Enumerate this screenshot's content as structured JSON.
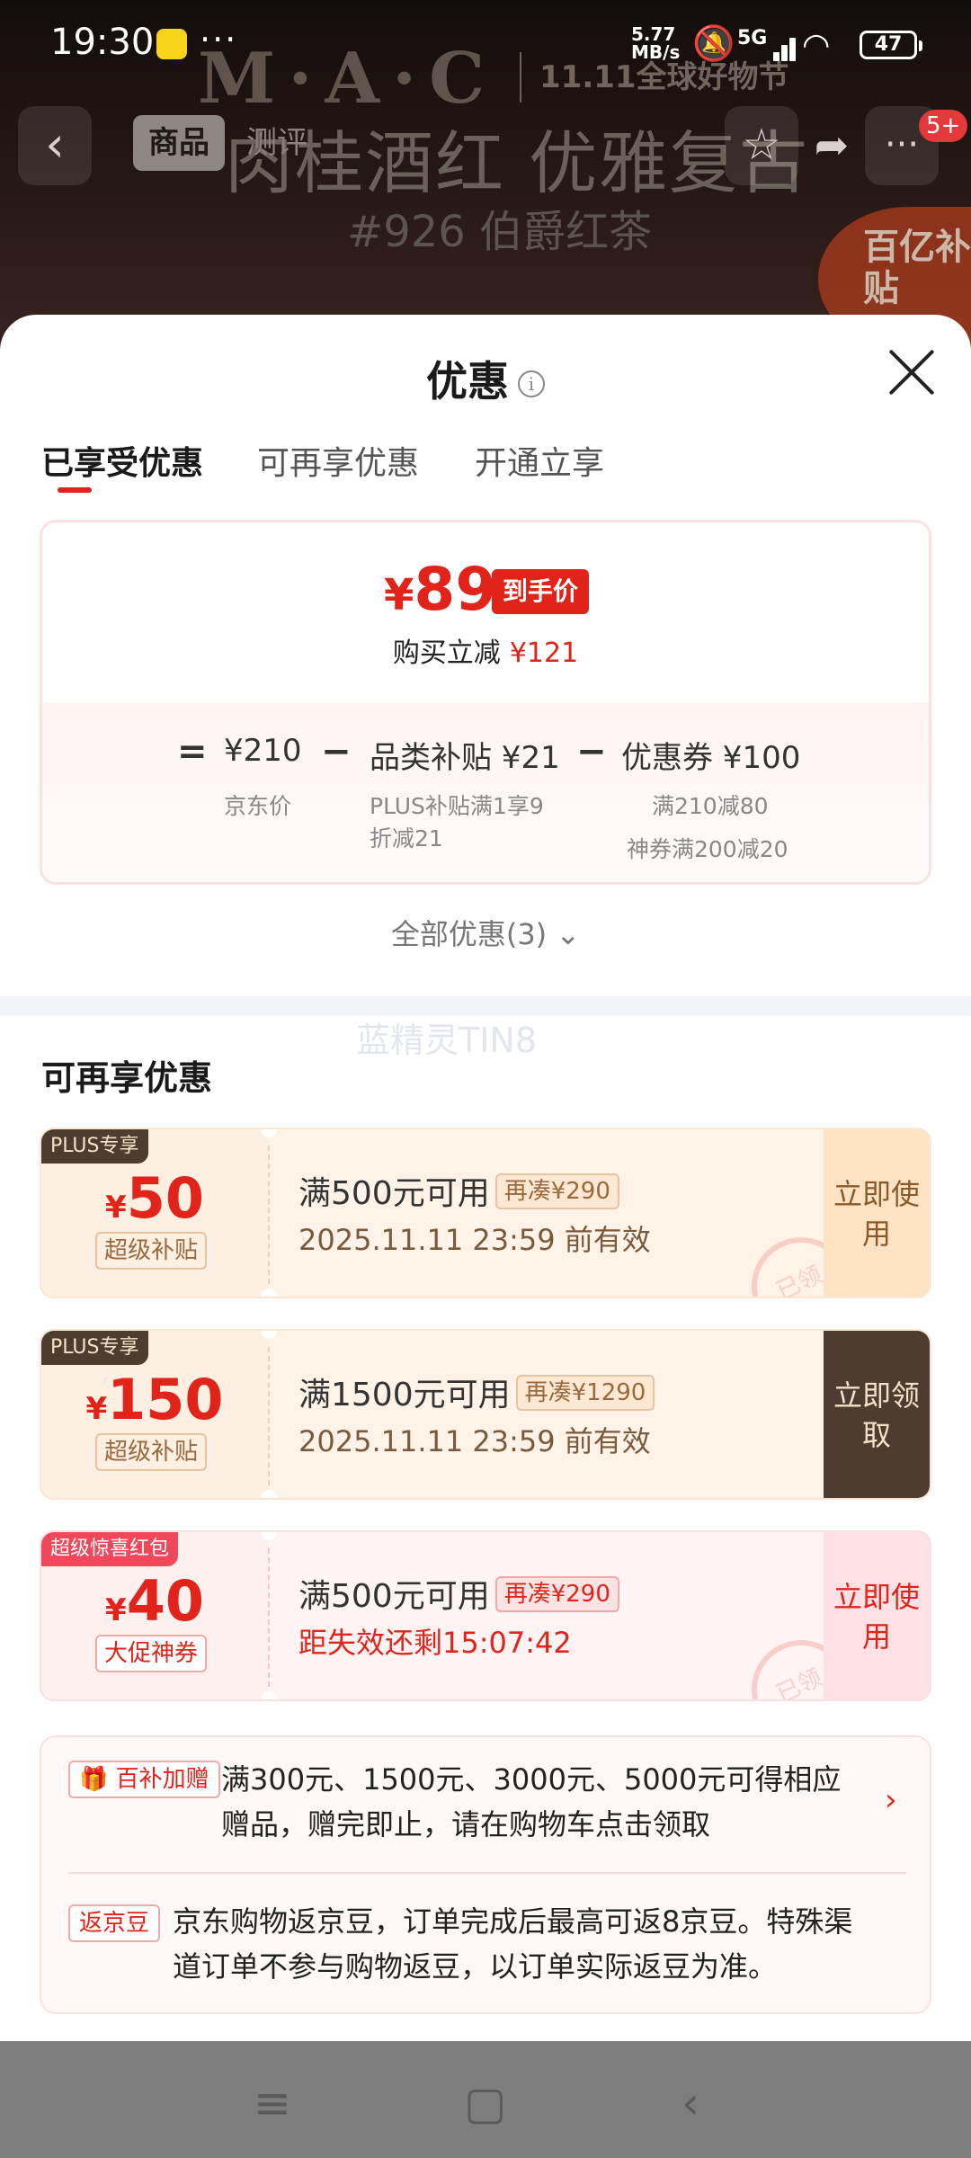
{
  "status_bar": {
    "time": "19:30",
    "dots": "···",
    "net_speed_value": "5.77",
    "net_speed_unit": "MB/s",
    "network": "5G",
    "battery": "47"
  },
  "background": {
    "brand": "M·A·C",
    "festival": "11.11全球好物节",
    "headline": "肉桂酒红 优雅复古",
    "shade": "#926 伯爵红茶",
    "badge": "百亿补贴"
  },
  "nav": {
    "tab_product": "商品",
    "tab_review": "测评",
    "more_badge": "5+"
  },
  "sheet": {
    "title": "优惠",
    "tabs": [
      "已享受优惠",
      "可再享优惠",
      "开通立享"
    ],
    "active_tab": 0
  },
  "summary": {
    "final_currency": "¥",
    "final_price": "89",
    "final_tag": "到手价",
    "saved_label": "购买立减",
    "saved_amount": "¥121",
    "equals": "=",
    "minus": "−",
    "jd_price_main": "¥210",
    "jd_price_label": "京东价",
    "subsidy_main": "品类补贴 ¥21",
    "subsidy_desc": "PLUS补贴满1享9折减21",
    "coupon_main": "优惠券 ¥100",
    "coupon_desc_1": "满210减80",
    "coupon_desc_2": "神券满200减20"
  },
  "all_offers": "全部优惠(3)",
  "watermark": "蓝精灵TIN8",
  "section_title": "可再享优惠",
  "coupons": [
    {
      "badge": "PLUS专享",
      "currency": "¥",
      "amount": "50",
      "type": "超级补贴",
      "condition": "满500元可用",
      "extra": "再凑¥290",
      "expiry": "2025.11.11 23:59 前有效",
      "button": "立即使用",
      "stamp": "已领"
    },
    {
      "badge": "PLUS专享",
      "currency": "¥",
      "amount": "150",
      "type": "超级补贴",
      "condition": "满1500元可用",
      "extra": "再凑¥1290",
      "expiry": "2025.11.11 23:59 前有效",
      "button": "立即领取"
    },
    {
      "badge": "超级惊喜红包",
      "currency": "¥",
      "amount": "40",
      "type": "大促神券",
      "condition": "满500元可用",
      "extra": "再凑¥290",
      "expiry": "距失效还剩15:07:42",
      "button": "立即使用",
      "stamp": "已领"
    }
  ],
  "gifts": {
    "tag1": "百补加赠",
    "text1_line1": "满300元、1500元、3000元、5000元可得相应",
    "text1_line2": "赠品，赠完即止，请在购物车点击领取",
    "tag2": "返京豆",
    "text2_line1": "京东购物返京豆，订单完成后最高可返8京豆。特殊渠",
    "text2_line2": "道订单不参与购物返豆，以订单实际返豆为准。"
  },
  "colors": {
    "accent": "#e2231a",
    "plus_dark": "#4e3c30",
    "plus_gold": "#f3e1c8",
    "tab_underline": "#e2231a"
  }
}
